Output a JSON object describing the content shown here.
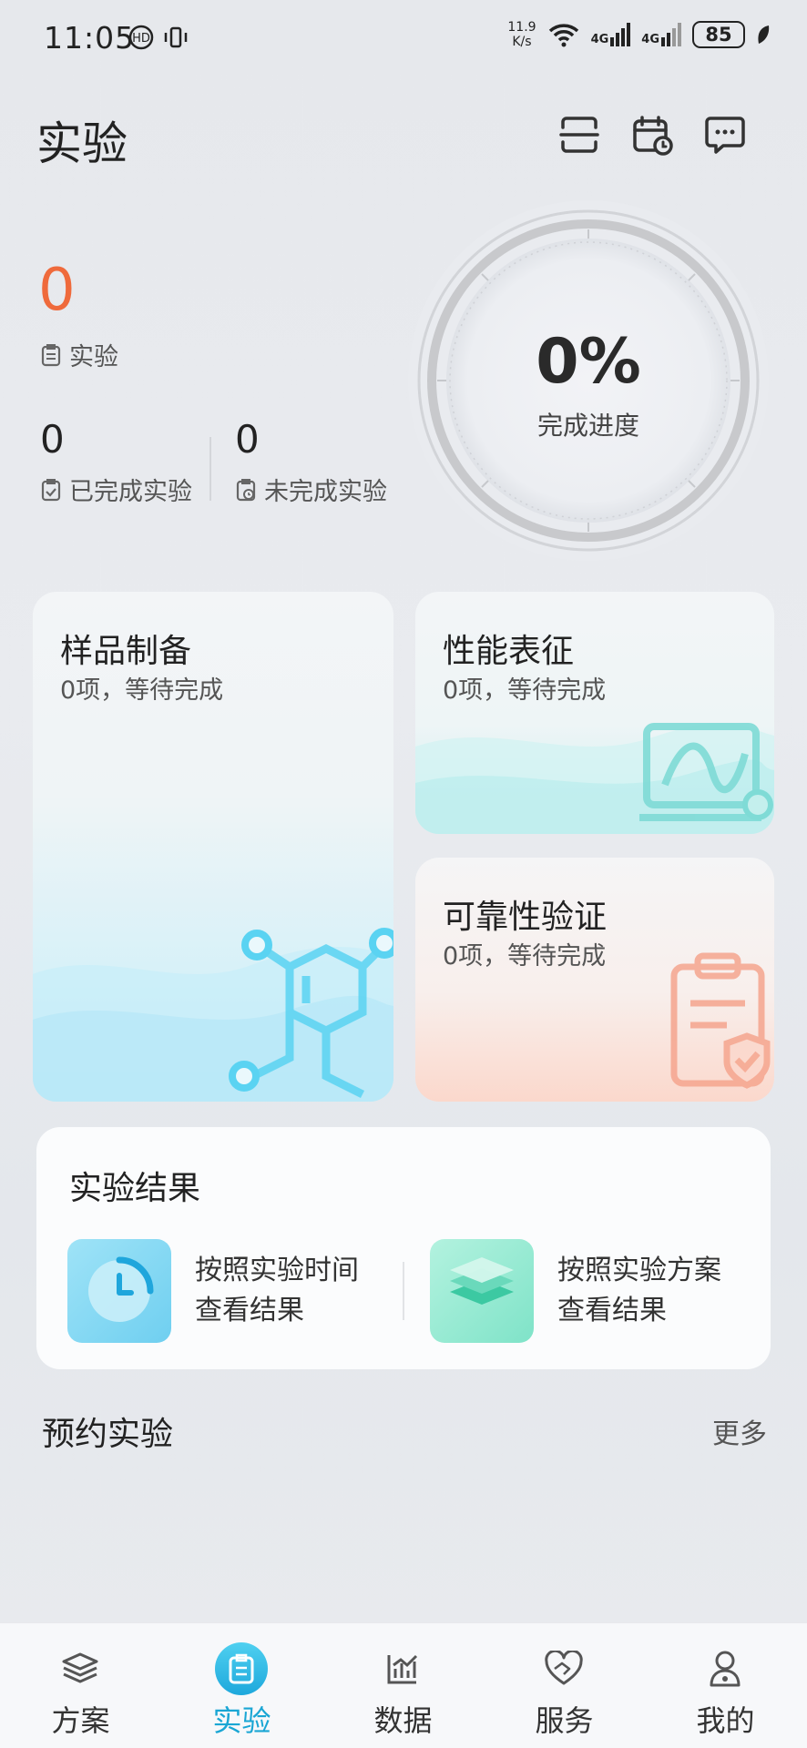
{
  "status": {
    "time": "11:05",
    "speed_value": "11.9",
    "speed_unit": "K/s",
    "signal1": "4G",
    "signal2": "4G",
    "battery": "85"
  },
  "header": {
    "title": "实验",
    "icons": [
      "scan-icon",
      "calendar-clock-icon",
      "message-icon"
    ]
  },
  "stats": {
    "total_count": "0",
    "total_label": "实验",
    "completed_count": "0",
    "completed_label": "已完成实验",
    "uncompleted_count": "0",
    "uncompleted_label": "未完成实验"
  },
  "progress": {
    "value": "0%",
    "label": "完成进度",
    "fraction": 0
  },
  "cards": {
    "sample": {
      "title": "样品制备",
      "subtitle": "0项，等待完成"
    },
    "performance": {
      "title": "性能表征",
      "subtitle": "0项，等待完成"
    },
    "reliability": {
      "title": "可靠性验证",
      "subtitle": "0项，等待完成"
    }
  },
  "results": {
    "title": "实验结果",
    "by_time_line1": "按照实验时间",
    "by_time_line2": "查看结果",
    "by_plan_line1": "按照实验方案",
    "by_plan_line2": "查看结果"
  },
  "booking": {
    "title": "预约实验",
    "more": "更多"
  },
  "nav": [
    {
      "label": "方案",
      "icon": "layers-icon",
      "active": false
    },
    {
      "label": "实验",
      "icon": "clipboard-icon",
      "active": true
    },
    {
      "label": "数据",
      "icon": "chart-icon",
      "active": false
    },
    {
      "label": "服务",
      "icon": "handshake-heart-icon",
      "active": false
    },
    {
      "label": "我的",
      "icon": "person-icon",
      "active": false
    }
  ],
  "colors": {
    "accent": "#1aa6d4",
    "count_highlight": "#ef6a3c"
  }
}
